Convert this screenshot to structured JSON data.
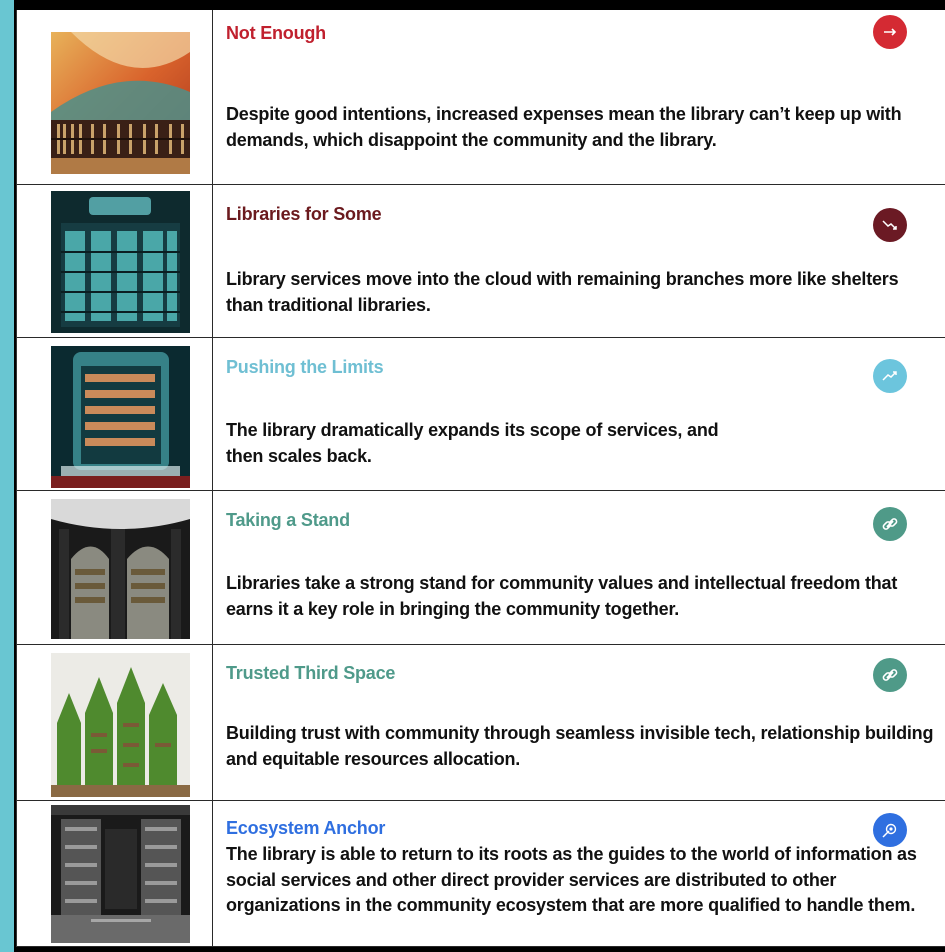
{
  "rows": [
    {
      "title": "Not Enough",
      "title_color": "#c0202e",
      "badge_color": "#d42a33",
      "badge_icon": "arrow-right-icon",
      "description": "Despite good intentions, increased expenses mean the library can’t keep up with demands, which disappoint the community and the library."
    },
    {
      "title": "Libraries for Some",
      "title_color": "#6b1a1e",
      "badge_color": "#6b1a24",
      "badge_icon": "trend-down-icon",
      "description": "Library services move into the cloud with remaining branches more like shelters than traditional libraries."
    },
    {
      "title": "Pushing the Limits",
      "title_color": "#6fbfd3",
      "badge_color": "#6cc5dd",
      "badge_icon": "trend-up-icon",
      "description_lines": [
        "The library dramatically expands its scope of services, and",
        "then scales back."
      ]
    },
    {
      "title": "Taking a Stand",
      "title_color": "#4f9a8a",
      "badge_color": "#4f9a88",
      "badge_icon": "link-icon",
      "description": "Libraries take a strong stand for community values and intellectual freedom that earns it a key role in bringing the community together."
    },
    {
      "title": "Trusted Third Space",
      "title_color": "#4f9a8a",
      "badge_color": "#4f9a88",
      "badge_icon": "link-icon",
      "description": "Building trust with community through seamless invisible tech, relationship building and equitable resources allocation."
    },
    {
      "title": "Ecosystem Anchor",
      "title_color": "#2f6fe0",
      "badge_color": "#2f6fe0",
      "badge_icon": "target-arrow-icon",
      "description": "The library is able to return to its roots as the guides to the world of information as social services and other direct provider services are distributed to other organizations in the community ecosystem that are more qualified to handle them."
    }
  ]
}
